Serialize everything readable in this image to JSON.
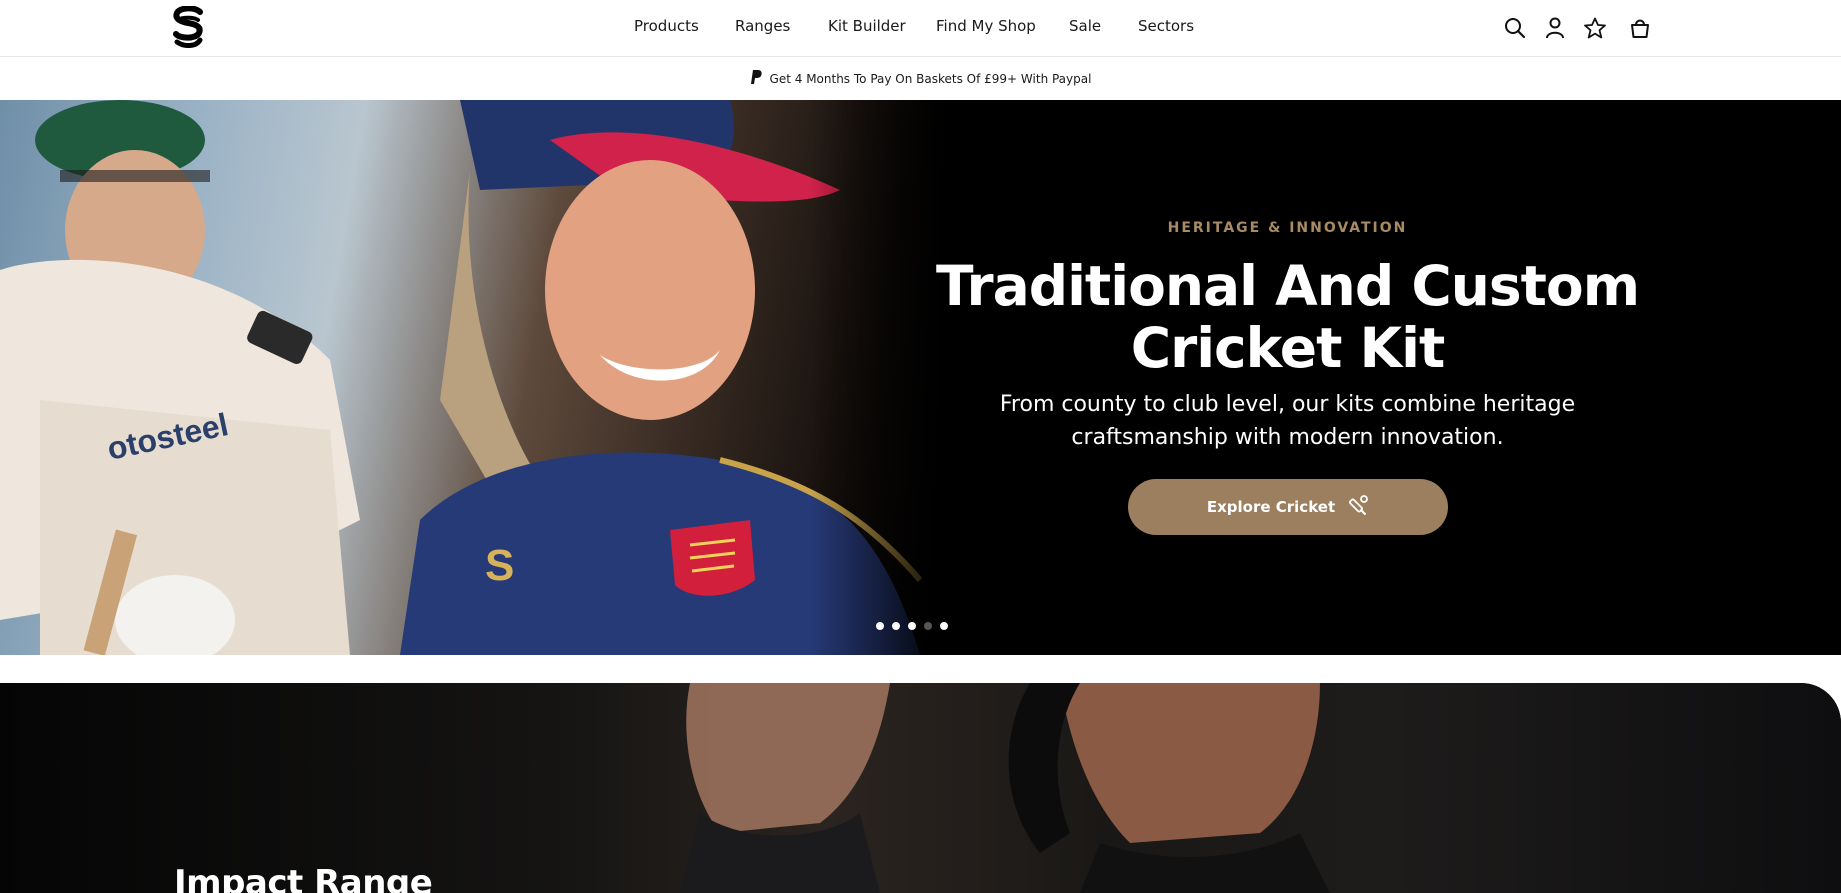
{
  "header": {
    "logo_icon": "sondico-s-logo-icon",
    "nav": [
      {
        "label": "Products"
      },
      {
        "label": "Ranges"
      },
      {
        "label": "Kit Builder"
      },
      {
        "label": "Find My Shop"
      },
      {
        "label": "Sale"
      },
      {
        "label": "Sectors"
      }
    ],
    "icons": [
      "search-icon",
      "account-icon",
      "wishlist-star-icon",
      "basket-icon"
    ]
  },
  "promo": {
    "icon": "paypal-icon",
    "text": "Get 4 Months To Pay On Baskets Of £99+  With Paypal"
  },
  "hero": {
    "eyebrow": "HERITAGE & INNOVATION",
    "title_line1": "Traditional And Custom",
    "title_line2": "Cricket Kit",
    "subtitle": "From county to club level, our kits combine heritage craftsmanship with modern innovation.",
    "button_label": "Explore Cricket",
    "button_icon": "cricket-bat-ball-icon",
    "slides": 5,
    "active_slide_indicator": "dot pattern: 3 white, 1 dim, 1 white",
    "accent_color": "#9b7f5e",
    "eyebrow_color": "#a88b64"
  },
  "range": {
    "title": "Impact Range"
  }
}
